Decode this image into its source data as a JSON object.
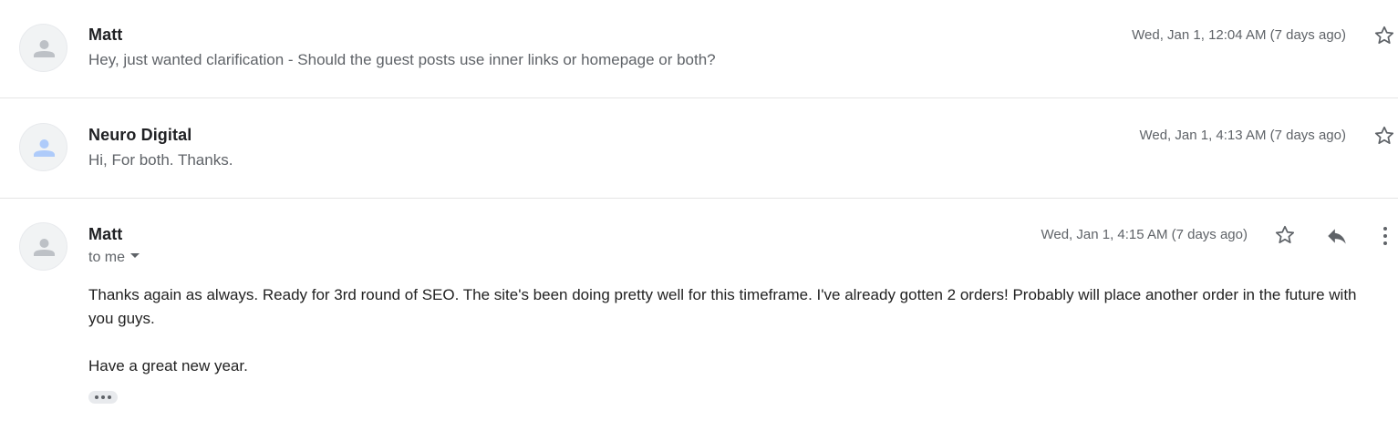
{
  "thread": {
    "messages": [
      {
        "sender": "Matt",
        "snippet": "Hey, just wanted clarification - Should the guest posts use inner links or homepage or both?",
        "date": "Wed, Jan 1, 12:04 AM (7 days ago)",
        "avatar_icon": "person-icon",
        "avatar_color": "#bdc1c6"
      },
      {
        "sender": "Neuro Digital",
        "snippet": "Hi, For both. Thanks.",
        "date": "Wed, Jan 1, 4:13 AM (7 days ago)",
        "avatar_icon": "person-icon",
        "avatar_color": "#aecbfa"
      },
      {
        "sender": "Matt",
        "recipient": "to me",
        "date": "Wed, Jan 1, 4:15 AM (7 days ago)",
        "avatar_icon": "person-icon",
        "avatar_color": "#bdc1c6",
        "body": [
          "Thanks again as always. Ready for 3rd round of SEO. The site's been doing pretty well for this timeframe. I've already gotten 2 orders! Probably will place another order in the future with you guys.",
          "Have a great new year."
        ]
      }
    ]
  },
  "icons": {
    "star": "star-icon",
    "reply": "reply-icon",
    "more": "more-vert-icon",
    "trimmed": "ellipsis-icon",
    "caret": "caret-down-icon"
  },
  "colors": {
    "icon": "#5f6368",
    "divider": "#e5e5e5"
  }
}
